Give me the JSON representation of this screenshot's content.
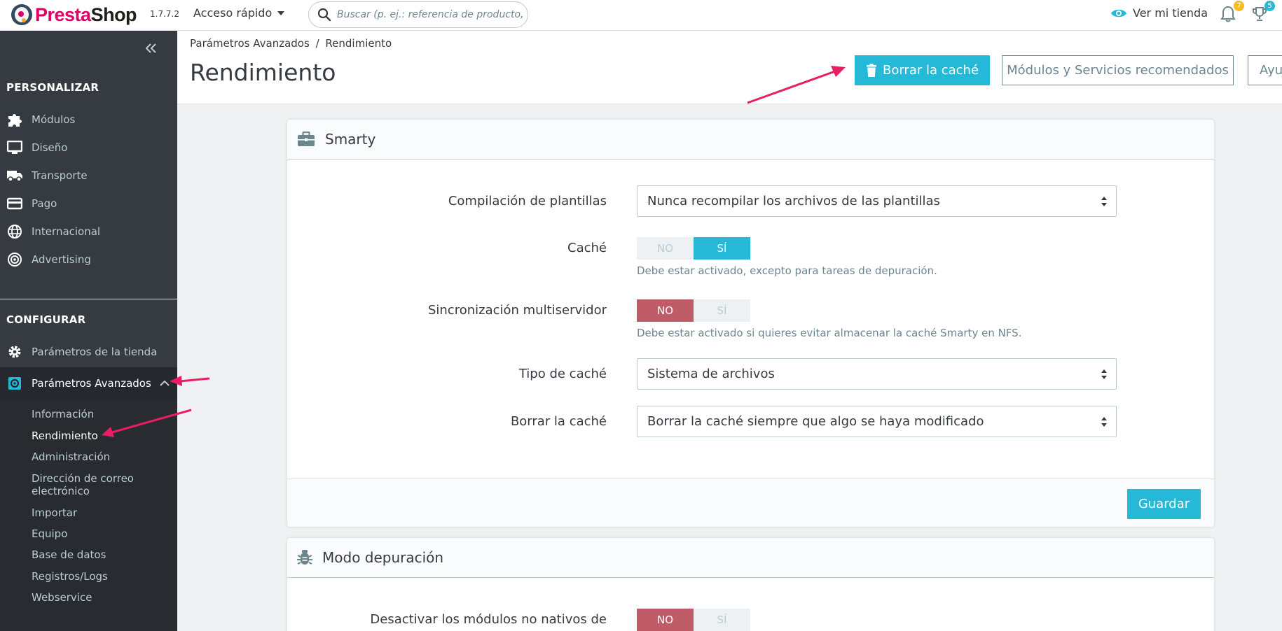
{
  "app": {
    "logo_prefix": "Presta",
    "logo_suffix": "Shop",
    "version": "1.7.7.2",
    "quick_access_label": "Acceso rápido",
    "search_placeholder": "Buscar (p. ej.: referencia de producto, nombre de cliente...)",
    "view_store_label": "Ver mi tienda",
    "notifications_count": "7",
    "trophy_count": "5"
  },
  "colors": {
    "accent": "#25b9d7",
    "sidebar_bg": "#363a41",
    "danger": "#c05c67",
    "badge_orange": "#fbbb22",
    "annotation_arrow": "#ea1d63"
  },
  "sidebar": {
    "collapse_icon": "double-chevron-left-icon",
    "section_personalize": "PERSONALIZAR",
    "personalize_items": [
      {
        "label": "Módulos",
        "icon": "puzzle-icon"
      },
      {
        "label": "Diseño",
        "icon": "monitor-icon"
      },
      {
        "label": "Transporte",
        "icon": "truck-icon"
      },
      {
        "label": "Pago",
        "icon": "credit-card-icon"
      },
      {
        "label": "Internacional",
        "icon": "globe-icon"
      },
      {
        "label": "Advertising",
        "icon": "target-icon"
      }
    ],
    "section_configure": "CONFIGURAR",
    "configure_items": [
      {
        "label": "Parámetros de la tienda",
        "icon": "gear-icon"
      },
      {
        "label": "Parámetros Avanzados",
        "icon": "advanced-gear-icon"
      }
    ],
    "submenu": [
      {
        "label": "Información"
      },
      {
        "label": "Rendimiento"
      },
      {
        "label": "Administración"
      },
      {
        "label": "Dirección de correo electrónico"
      },
      {
        "label": "Importar"
      },
      {
        "label": "Equipo"
      },
      {
        "label": "Base de datos"
      },
      {
        "label": "Registros/Logs"
      },
      {
        "label": "Webservice"
      }
    ]
  },
  "header": {
    "breadcrumb_parent": "Parámetros Avanzados",
    "breadcrumb_separator": "/",
    "breadcrumb_current": "Rendimiento",
    "title": "Rendimiento",
    "clear_cache_button": "Borrar la caché",
    "recommended_button": "Módulos y Servicios recomendados",
    "help_button": "Ayuda"
  },
  "smarty": {
    "title": "Smarty",
    "template_compilation_label": "Compilación de plantillas",
    "template_compilation_value": "Nunca recompilar los archivos de las plantillas",
    "cache_label": "Caché",
    "cache_no": "NO",
    "cache_yes": "SÍ",
    "cache_help": "Debe estar activado, excepto para tareas de depuración.",
    "multiserver_label": "Sincronización multiservidor",
    "multiserver_no": "NO",
    "multiserver_yes": "SÍ",
    "multiserver_help": "Debe estar activado si quieres evitar almacenar la caché Smarty en NFS.",
    "cache_type_label": "Tipo de caché",
    "cache_type_value": "Sistema de archivos",
    "clear_cache_label": "Borrar la caché",
    "clear_cache_value": "Borrar la caché siempre que algo se haya modificado",
    "save_button": "Guardar"
  },
  "debug": {
    "title": "Modo depuración",
    "disable_modules_label": "Desactivar los módulos no nativos de",
    "disable_no": "NO",
    "disable_yes": "SÍ"
  }
}
